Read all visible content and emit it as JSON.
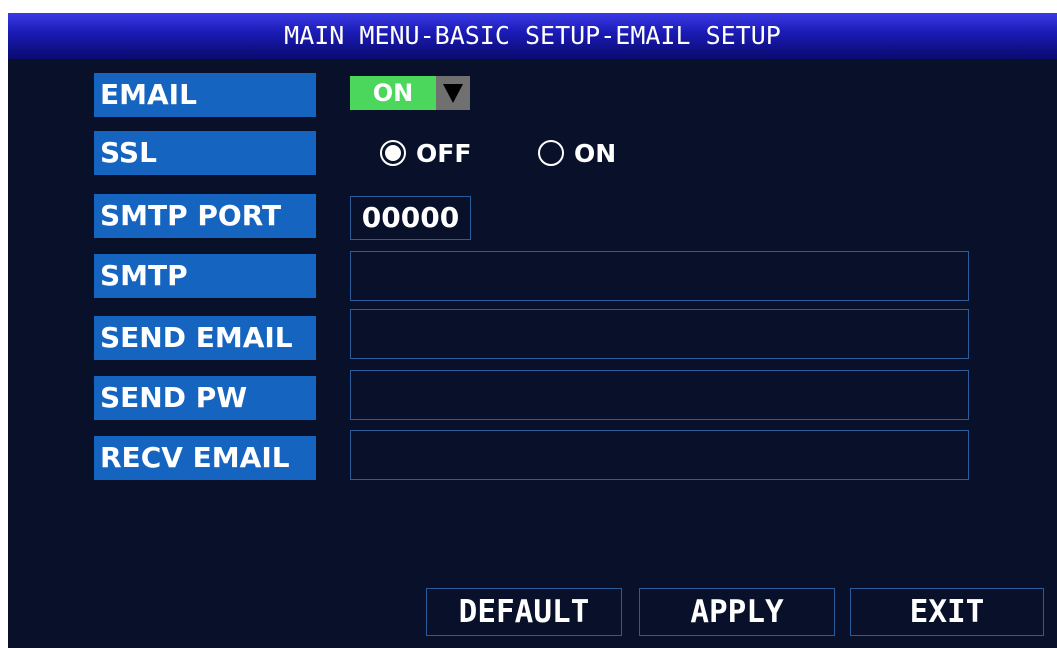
{
  "title": "MAIN MENU-BASIC SETUP-EMAIL SETUP",
  "labels": {
    "email": "EMAIL",
    "ssl": "SSL",
    "smtp_port": "SMTP PORT",
    "smtp": "SMTP",
    "send_email": "SEND EMAIL",
    "send_pw": "SEND PW",
    "recv_email": "RECV EMAIL"
  },
  "email_select": {
    "value": "ON",
    "icon": "triangle-down-icon"
  },
  "ssl_options": {
    "off": "OFF",
    "on": "ON",
    "selected": "OFF"
  },
  "smtp_port_value": "00000",
  "fields": {
    "smtp": "",
    "send_email": "",
    "send_pw": "",
    "recv_email": ""
  },
  "buttons": {
    "default": "DEFAULT",
    "apply": "APPLY",
    "exit": "EXIT"
  },
  "colors": {
    "background": "#09112a",
    "label_bg": "#1565c0",
    "toggle_on": "#4bd65c",
    "field_border": "#2c5d9a"
  }
}
